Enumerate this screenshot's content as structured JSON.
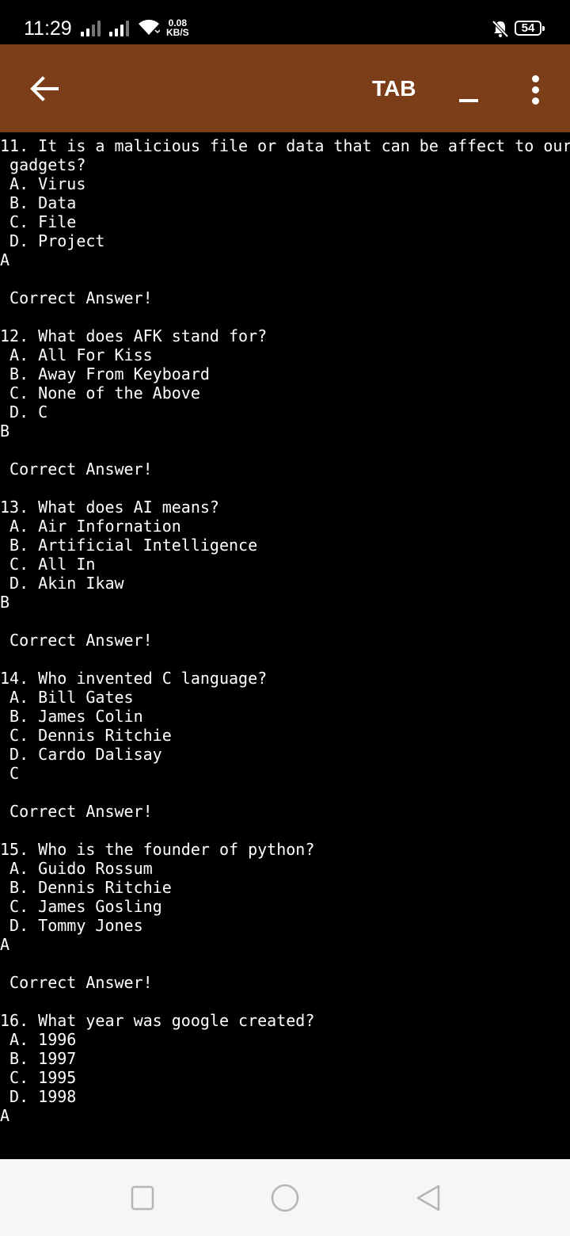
{
  "status_bar": {
    "time": "11:29",
    "net_speed_value": "0.08",
    "net_speed_unit": "KB/S",
    "battery": "54"
  },
  "app_bar": {
    "title": "TAB",
    "colors": {
      "background": "#7b3e19"
    }
  },
  "terminal": {
    "lines": [
      "11. It is a malicious file or data that can be affect to our",
      " gadgets?",
      " A. Virus",
      " B. Data",
      " C. File",
      " D. Project",
      "A",
      "",
      " Correct Answer!",
      "",
      "12. What does AFK stand for?",
      " A. All For Kiss",
      " B. Away From Keyboard",
      " C. None of the Above",
      " D. C",
      "B",
      "",
      " Correct Answer!",
      "",
      "13. What does AI means?",
      " A. Air Infornation",
      " B. Artificial Intelligence",
      " C. All In",
      " D. Akin Ikaw",
      "B",
      "",
      " Correct Answer!",
      "",
      "14. Who invented C language?",
      " A. Bill Gates",
      " B. James Colin",
      " C. Dennis Ritchie",
      " D. Cardo Dalisay",
      " C",
      "",
      " Correct Answer!",
      "",
      "15. Who is the founder of python?",
      " A. Guido Rossum",
      " B. Dennis Ritchie",
      " C. James Gosling",
      " D. Tommy Jones",
      "A",
      "",
      " Correct Answer!",
      "",
      "16. What year was google created?",
      " A. 1996",
      " B. 1997",
      " C. 1995",
      " D. 1998",
      "A"
    ]
  },
  "nav_bar": {
    "icons": [
      "recents-square-icon",
      "home-circle-icon",
      "back-triangle-icon"
    ]
  }
}
